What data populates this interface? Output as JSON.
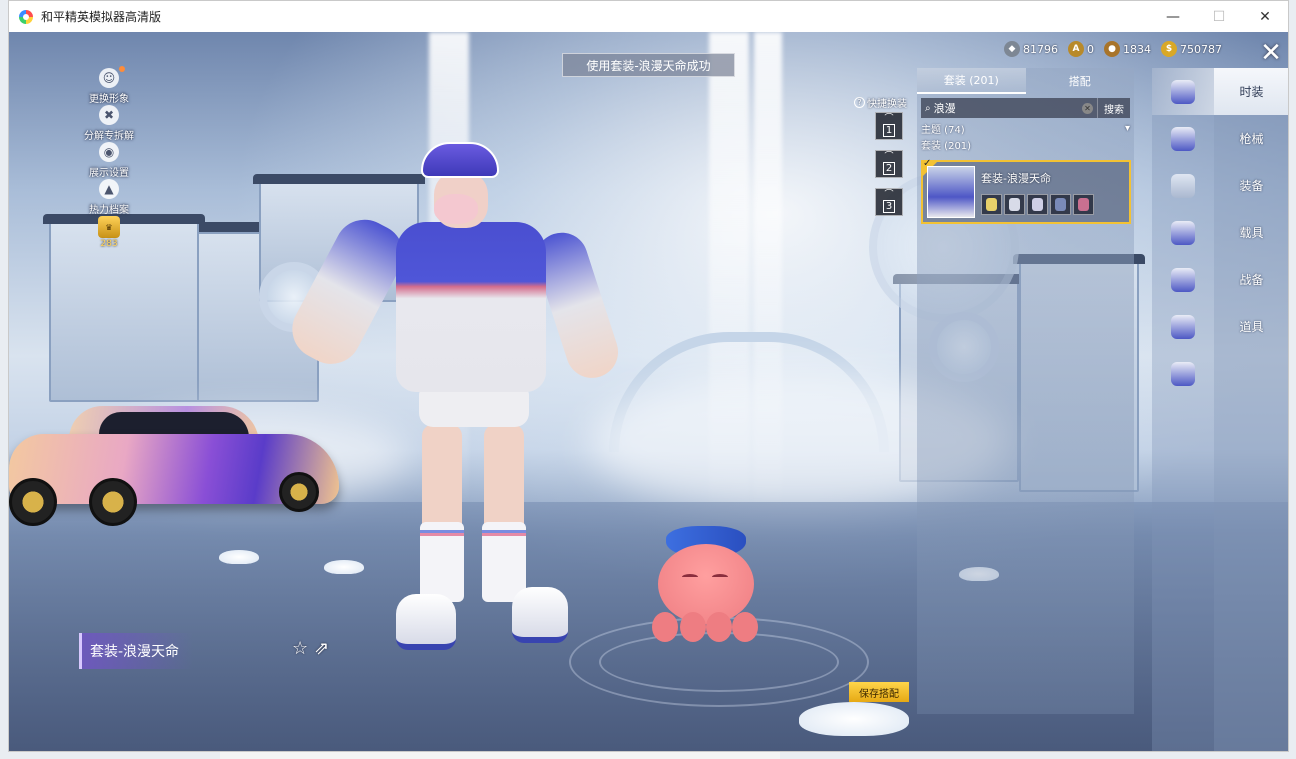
{
  "window": {
    "title": "和平精英模拟器高清版",
    "minimize": "—",
    "maximize": "☐",
    "close": "✕"
  },
  "toast": "使用套装-浪漫天命成功",
  "currencies": [
    {
      "icon": "silver-coin-icon",
      "value": "81796",
      "color": "#7d8794"
    },
    {
      "icon": "bond-coin-icon",
      "value": "0",
      "color": "#b88a2a"
    },
    {
      "icon": "badge-coin-icon",
      "value": "1834",
      "color": "#a8742a"
    },
    {
      "icon": "gold-coin-icon",
      "value": "750787",
      "color": "#d9a826"
    }
  ],
  "close_button": "✕",
  "left_menu": [
    {
      "label": "更换形象",
      "icon": "avatar-icon",
      "has_dot": true
    },
    {
      "label": "分解专拆解",
      "icon": "dismantle-icon",
      "has_dot": false
    },
    {
      "label": "展示设置",
      "icon": "eye-icon",
      "has_dot": false
    },
    {
      "label": "热力档案",
      "icon": "fire-icon",
      "has_dot": false
    }
  ],
  "rank_badge": {
    "value": "283"
  },
  "swap": {
    "label": "快捷换装",
    "slots": [
      "1",
      "2",
      "3"
    ]
  },
  "panel": {
    "tabs": [
      {
        "label": "套装 (201)",
        "active": true
      },
      {
        "label": "搭配",
        "active": false
      }
    ],
    "search": {
      "value": "浪漫",
      "button": "搜索"
    },
    "theme_row": "主题 (74)",
    "outfit_row": "套装 (201)",
    "result": {
      "title": "套装-浪漫天命",
      "item_colors": [
        "#e7d06a",
        "#d8dbe8",
        "#cfcfe6",
        "#7a8ab8",
        "#c97090"
      ]
    }
  },
  "categories": [
    {
      "label": "时装",
      "active": true
    },
    {
      "label": "枪械",
      "active": false
    },
    {
      "label": "装备",
      "active": false
    },
    {
      "label": "载具",
      "active": false
    },
    {
      "label": "战备",
      "active": false
    },
    {
      "label": "道具",
      "active": false
    }
  ],
  "bottom": {
    "outfit_name": "套装-浪漫天命",
    "save_button": "保存搭配"
  },
  "colors": {
    "accent_gold": "#f3c233",
    "active_tab_bg": "#f5f7fb",
    "outfit_name_bg": "#6e58be"
  }
}
